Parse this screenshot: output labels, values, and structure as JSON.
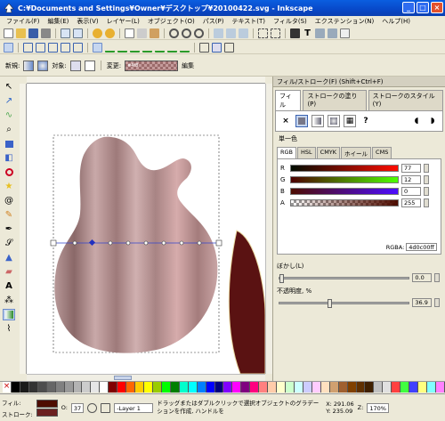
{
  "window": {
    "title": "C:¥Documents and Settings¥Owner¥デスクトップ¥20100422.svg - Inkscape"
  },
  "menu": [
    "ファイル(F)",
    "編集(E)",
    "表示(V)",
    "レイヤー(L)",
    "オブジェクト(O)",
    "パス(P)",
    "テキスト(T)",
    "フィルタ(S)",
    "エクステンション(N)",
    "ヘルプ(H)"
  ],
  "controls": {
    "new_label": "新規:",
    "target_label": "対象:",
    "change_label": "変更:",
    "edit_label": "編集",
    "gradient_id": "#4f8"
  },
  "dock": {
    "title": "フィル/ストローク(F) (Shift+Ctrl+F)",
    "tabs": [
      "フィル",
      "ストロークの塗り(P)",
      "ストロークのスタイル(Y)"
    ],
    "paint_none": "×",
    "paint_unknown": "?",
    "flat_label": "単一色",
    "color_tabs": [
      "RGB",
      "HSL",
      "CMYK",
      "ホイール",
      "CMS"
    ],
    "channels": [
      {
        "label": "R",
        "value": "77"
      },
      {
        "label": "G",
        "value": "12"
      },
      {
        "label": "B",
        "value": "0"
      },
      {
        "label": "A",
        "value": "255"
      }
    ],
    "rgba_label": "RGBA:",
    "rgba_value": "4d0c00ff",
    "blur_label": "ぼかし(L)",
    "blur_value": "0.0",
    "blur_fraction": 0.0,
    "opacity_label": "不透明度, %",
    "opacity_value": "36.9",
    "opacity_fraction": 0.369
  },
  "status": {
    "fill_label": "フィル:",
    "stroke_label": "ストローク:",
    "opacity_label": "O:",
    "opacity_value": "37",
    "layer_value": "-Layer 1",
    "message": "ドラッグまたはダブルクリックで選択オブジェクトのグラデーションを作成, ハンドルを",
    "x_label": "X:",
    "x_value": "291.06",
    "y_label": "Y:",
    "y_value": "235.09",
    "zoom_label": "Z:",
    "zoom_value": "170%"
  },
  "colors": {
    "fill_swatch": "#4d0c00",
    "stroke_swatch": "#6b2020",
    "palette": [
      "#000000",
      "#1a1a1a",
      "#333333",
      "#4d4d4d",
      "#666666",
      "#808080",
      "#999999",
      "#b3b3b3",
      "#cccccc",
      "#e6e6e6",
      "#ffffff",
      "#800000",
      "#ff0000",
      "#ff6600",
      "#ffcc00",
      "#ffff00",
      "#99cc00",
      "#00ff00",
      "#008000",
      "#00ffcc",
      "#00ffff",
      "#0080ff",
      "#0000ff",
      "#000080",
      "#8000ff",
      "#ff00ff",
      "#800080",
      "#ff0080",
      "#ff8080",
      "#ffccaa",
      "#ffffcc",
      "#ccffcc",
      "#ccffff",
      "#ccccff",
      "#ffccff",
      "#ffe0c0",
      "#d0a070",
      "#a06030",
      "#804000",
      "#603000",
      "#402000",
      "#c0c0c0",
      "#e0e0e0",
      "#ff4040",
      "#40ff40",
      "#4040ff",
      "#ffff80",
      "#80ffff",
      "#ff80ff"
    ]
  }
}
